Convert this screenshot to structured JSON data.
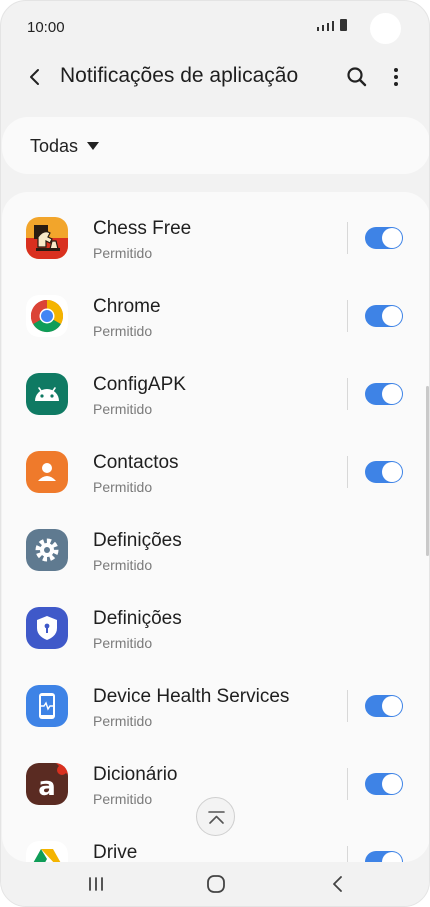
{
  "status_bar": {
    "time": "10:00"
  },
  "header": {
    "title": "Notificações de aplicação"
  },
  "filter": {
    "label": "Todas"
  },
  "apps": [
    {
      "name": "Chess Free",
      "status": "Permitido",
      "toggle_on": true,
      "icon": "chess-icon"
    },
    {
      "name": "Chrome",
      "status": "Permitido",
      "toggle_on": true,
      "icon": "chrome-icon"
    },
    {
      "name": "ConfigAPK",
      "status": "Permitido",
      "toggle_on": true,
      "icon": "android-icon"
    },
    {
      "name": "Contactos",
      "status": "Permitido",
      "toggle_on": true,
      "icon": "contacts-icon"
    },
    {
      "name": "Definições",
      "status": "Permitido",
      "toggle_on": null,
      "icon": "settings-icon"
    },
    {
      "name": "Definições",
      "status": "Permitido",
      "toggle_on": null,
      "icon": "security-icon"
    },
    {
      "name": "Device Health Services",
      "status": "Permitido",
      "toggle_on": true,
      "icon": "device-health-icon"
    },
    {
      "name": "Dicionário",
      "status": "Permitido",
      "toggle_on": true,
      "icon": "dictionary-icon"
    },
    {
      "name": "Drive",
      "status": "",
      "toggle_on": true,
      "icon": "drive-icon"
    }
  ],
  "colors": {
    "toggle_on": "#3e83e6",
    "background": "#f2f2f2",
    "card": "#fafafa"
  }
}
